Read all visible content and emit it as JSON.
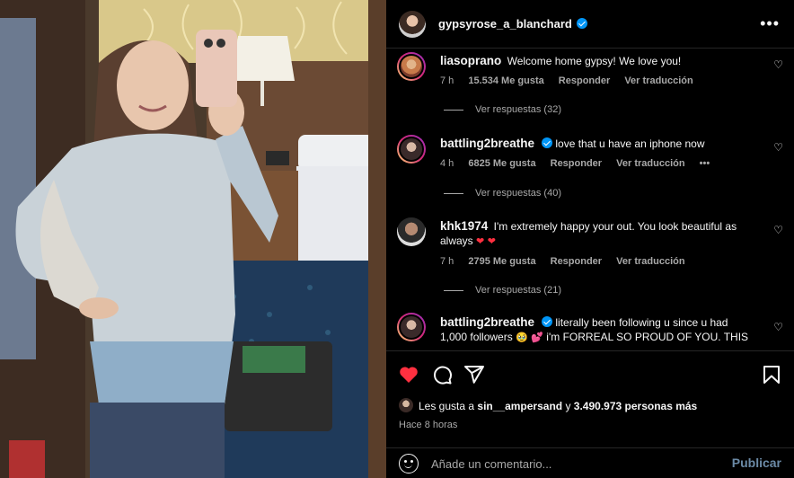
{
  "post": {
    "username": "gypsyrose_a_blanchard",
    "verified": true,
    "more_label": "•••"
  },
  "comments": [
    {
      "username": "liasoprano",
      "text": "Welcome home gypsy! We love you!",
      "time": "7 h",
      "likes": "15.534 Me gusta",
      "reply_label": "Responder",
      "translate_label": "Ver traducción",
      "view_replies": "Ver respuestas (32)",
      "avatar_color": "#c77a4a"
    },
    {
      "username": "battling2breathe",
      "verified": true,
      "text": "love that u have an iphone now",
      "time": "4 h",
      "likes": "6825 Me gusta",
      "reply_label": "Responder",
      "translate_label": "Ver traducción",
      "extra": "•••",
      "view_replies": "Ver respuestas (40)",
      "avatar_color": "#5a4a44"
    },
    {
      "username": "khk1974",
      "text": "I'm extremely happy your out. You look beautiful as always",
      "emoji": "❤ ❤",
      "time": "7 h",
      "likes": "2795 Me gusta",
      "reply_label": "Responder",
      "translate_label": "Ver traducción",
      "view_replies": "Ver respuestas (21)",
      "avatar_color": "#6a5a52"
    },
    {
      "username": "battling2breathe",
      "verified": true,
      "text_a": "literally been following u since u had 1,000 followers",
      "emoji": "🥹 💕",
      "text_b": "i'm FORREAL SO PROUD OF YOU. THIS",
      "avatar_color": "#5a4a44"
    }
  ],
  "likes": {
    "prefix": "Les gusta a",
    "user": "sin__ampersand",
    "connector": "y",
    "count": "3.490.973 personas más"
  },
  "time_ago": "Hace 8 horas",
  "comment_box": {
    "placeholder": "Añade un comentario...",
    "post_label": "Publicar"
  },
  "colors": {
    "accent_blue": "#0095f6",
    "like_red": "#ff3040",
    "background": "#000000"
  },
  "icons": [
    "heart-icon",
    "comment-icon",
    "share-icon",
    "bookmark-icon",
    "emoji-icon",
    "more-icon"
  ]
}
